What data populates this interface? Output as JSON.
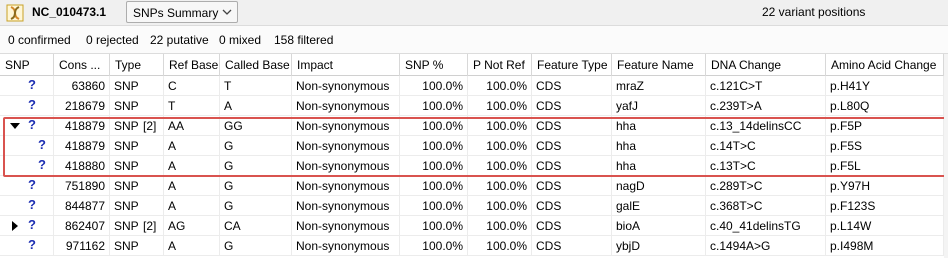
{
  "toolbar": {
    "sequence_name": "NC_010473.1",
    "view_select": "SNPs Summary",
    "variant_positions": "22 variant positions"
  },
  "status": {
    "confirmed": "0 confirmed",
    "rejected": "0 rejected",
    "putative": "22 putative",
    "mixed": "0 mixed",
    "filtered": "158 filtered"
  },
  "table": {
    "columns": [
      "SNP",
      "Cons ...",
      "Type",
      "Ref Base",
      "Called Base",
      "Impact",
      "SNP %",
      "P Not Ref",
      "Feature Type",
      "Feature Name",
      "DNA Change",
      "Amino Acid Change"
    ],
    "rows": [
      {
        "expander": "",
        "snp": "?",
        "cons": "63860",
        "type": "SNP",
        "count": "",
        "ref": "C",
        "called": "T",
        "impact": "Non-synonymous",
        "snp_pct": "100.0%",
        "pnotref": "100.0%",
        "ftype": "CDS",
        "fname": "mraZ",
        "dna": "c.121C>T",
        "aa": "p.H41Y"
      },
      {
        "expander": "",
        "snp": "?",
        "cons": "218679",
        "type": "SNP",
        "count": "",
        "ref": "T",
        "called": "A",
        "impact": "Non-synonymous",
        "snp_pct": "100.0%",
        "pnotref": "100.0%",
        "ftype": "CDS",
        "fname": "yafJ",
        "dna": "c.239T>A",
        "aa": "p.L80Q"
      },
      {
        "expander": "down",
        "snp": "?",
        "cons": "418879",
        "type": "SNP",
        "count": "[2]",
        "ref": "AA",
        "called": "GG",
        "impact": "Non-synonymous",
        "snp_pct": "100.0%",
        "pnotref": "100.0%",
        "ftype": "CDS",
        "fname": "hha",
        "dna": "c.13_14delinsCC",
        "aa": "p.F5P"
      },
      {
        "expander": "",
        "snp": "?",
        "cons": "418879",
        "type": "SNP",
        "count": "",
        "ref": "A",
        "called": "G",
        "impact": "Non-synonymous",
        "snp_pct": "100.0%",
        "pnotref": "100.0%",
        "ftype": "CDS",
        "fname": "hha",
        "dna": "c.14T>C",
        "aa": "p.F5S",
        "child": true
      },
      {
        "expander": "",
        "snp": "?",
        "cons": "418880",
        "type": "SNP",
        "count": "",
        "ref": "A",
        "called": "G",
        "impact": "Non-synonymous",
        "snp_pct": "100.0%",
        "pnotref": "100.0%",
        "ftype": "CDS",
        "fname": "hha",
        "dna": "c.13T>C",
        "aa": "p.F5L",
        "child": true
      },
      {
        "expander": "",
        "snp": "?",
        "cons": "751890",
        "type": "SNP",
        "count": "",
        "ref": "A",
        "called": "G",
        "impact": "Non-synonymous",
        "snp_pct": "100.0%",
        "pnotref": "100.0%",
        "ftype": "CDS",
        "fname": "nagD",
        "dna": "c.289T>C",
        "aa": "p.Y97H"
      },
      {
        "expander": "",
        "snp": "?",
        "cons": "844877",
        "type": "SNP",
        "count": "",
        "ref": "A",
        "called": "G",
        "impact": "Non-synonymous",
        "snp_pct": "100.0%",
        "pnotref": "100.0%",
        "ftype": "CDS",
        "fname": "galE",
        "dna": "c.368T>C",
        "aa": "p.F123S"
      },
      {
        "expander": "right",
        "snp": "?",
        "cons": "862407",
        "type": "SNP",
        "count": "[2]",
        "ref": "AG",
        "called": "CA",
        "impact": "Non-synonymous",
        "snp_pct": "100.0%",
        "pnotref": "100.0%",
        "ftype": "CDS",
        "fname": "bioA",
        "dna": "c.40_41delinsTG",
        "aa": "p.L14W"
      },
      {
        "expander": "",
        "snp": "?",
        "cons": "971162",
        "type": "SNP",
        "count": "",
        "ref": "A",
        "called": "G",
        "impact": "Non-synonymous",
        "snp_pct": "100.0%",
        "pnotref": "100.0%",
        "ftype": "CDS",
        "fname": "ybjD",
        "dna": "c.1494A>G",
        "aa": "p.I498M"
      }
    ]
  },
  "colors": {
    "question_mark": "#1c2eb3",
    "highlight_border": "#d9534f"
  }
}
